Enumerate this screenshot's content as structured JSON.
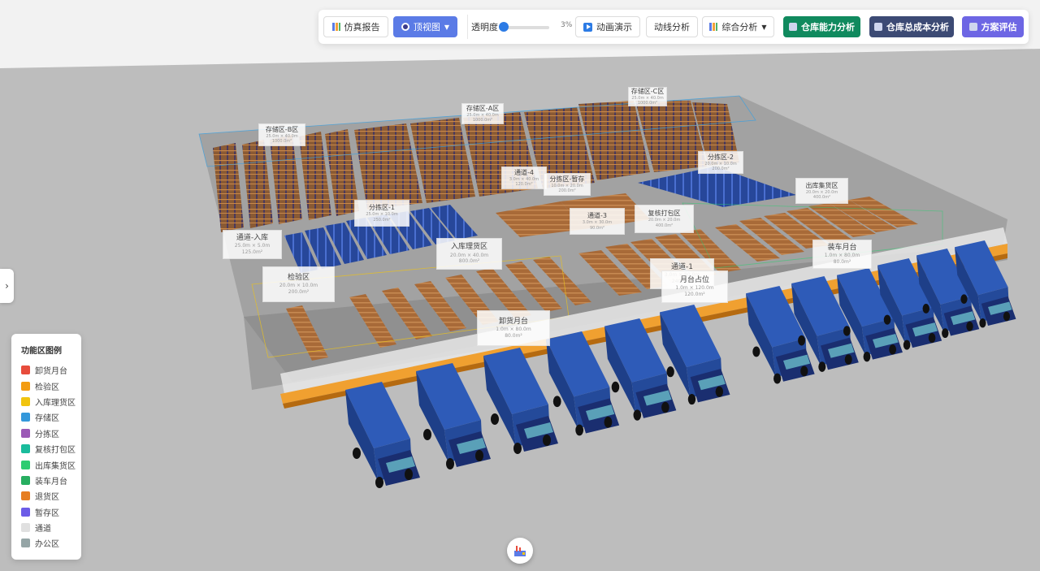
{
  "toolbar": {
    "report_label": "仿真报告",
    "view_label": "顶视图",
    "opacity_label": "透明度",
    "opacity_value": "3%",
    "animation_label": "动画演示",
    "flow_label": "动线分析",
    "combined_label": "综合分析",
    "capacity_label": "仓库能力分析",
    "cost_label": "仓库总成本分析",
    "evaluate_label": "方案评估"
  },
  "legend": {
    "title": "功能区图例",
    "items": [
      {
        "label": "卸货月台",
        "color": "#e74c3c"
      },
      {
        "label": "检验区",
        "color": "#f39c12"
      },
      {
        "label": "入库理货区",
        "color": "#f1c40f"
      },
      {
        "label": "存储区",
        "color": "#3498db"
      },
      {
        "label": "分拣区",
        "color": "#9b59b6"
      },
      {
        "label": "复核打包区",
        "color": "#1abc9c"
      },
      {
        "label": "出库集货区",
        "color": "#2ecc71"
      },
      {
        "label": "装车月台",
        "color": "#27ae60"
      },
      {
        "label": "退货区",
        "color": "#e67e22"
      },
      {
        "label": "暂存区",
        "color": "#6c5ce7"
      },
      {
        "label": "通道",
        "color": "#e0e0e0"
      },
      {
        "label": "办公区",
        "color": "#95a5a6"
      }
    ]
  },
  "zones": [
    {
      "title": "存储区-B区",
      "sub1": "25.0m × 40.0m",
      "sub2": "1000.0m²"
    },
    {
      "title": "存储区-A区",
      "sub1": "25.0m × 40.0m",
      "sub2": "1000.0m²"
    },
    {
      "title": "存储区-C区",
      "sub1": "25.0m × 40.0m",
      "sub2": "1000.0m²"
    },
    {
      "title": "分拣区-2",
      "sub1": "20.0m × 10.0m",
      "sub2": "200.0m²"
    },
    {
      "title": "通道-4",
      "sub1": "3.0m × 40.0m",
      "sub2": "120.0m²"
    },
    {
      "title": "分拣区-暂存",
      "sub1": "10.0m × 20.0m",
      "sub2": "200.0m²"
    },
    {
      "title": "出库集货区",
      "sub1": "20.0m × 20.0m",
      "sub2": "400.0m²"
    },
    {
      "title": "分拣区-1",
      "sub1": "25.0m × 10.0m",
      "sub2": "250.0m²"
    },
    {
      "title": "通道-3",
      "sub1": "3.0m × 30.0m",
      "sub2": "90.0m²"
    },
    {
      "title": "复核打包区",
      "sub1": "20.0m × 20.0m",
      "sub2": "400.0m²"
    },
    {
      "title": "通道-入库",
      "sub1": "25.0m × 5.0m",
      "sub2": "125.0m²"
    },
    {
      "title": "入库理货区",
      "sub1": "20.0m × 40.0m",
      "sub2": "800.0m²"
    },
    {
      "title": "装车月台",
      "sub1": "1.0m × 80.0m",
      "sub2": "80.0m²"
    },
    {
      "title": "通道-1",
      "sub1": "3.0m × 80.0m",
      "sub2": "240.0m²"
    },
    {
      "title": "检验区",
      "sub1": "20.0m × 10.0m",
      "sub2": "200.0m²"
    },
    {
      "title": "月台占位",
      "sub1": "1.0m × 120.0m",
      "sub2": "120.0m²"
    },
    {
      "title": "卸货月台",
      "sub1": "1.0m × 80.0m",
      "sub2": "80.0m²"
    }
  ]
}
